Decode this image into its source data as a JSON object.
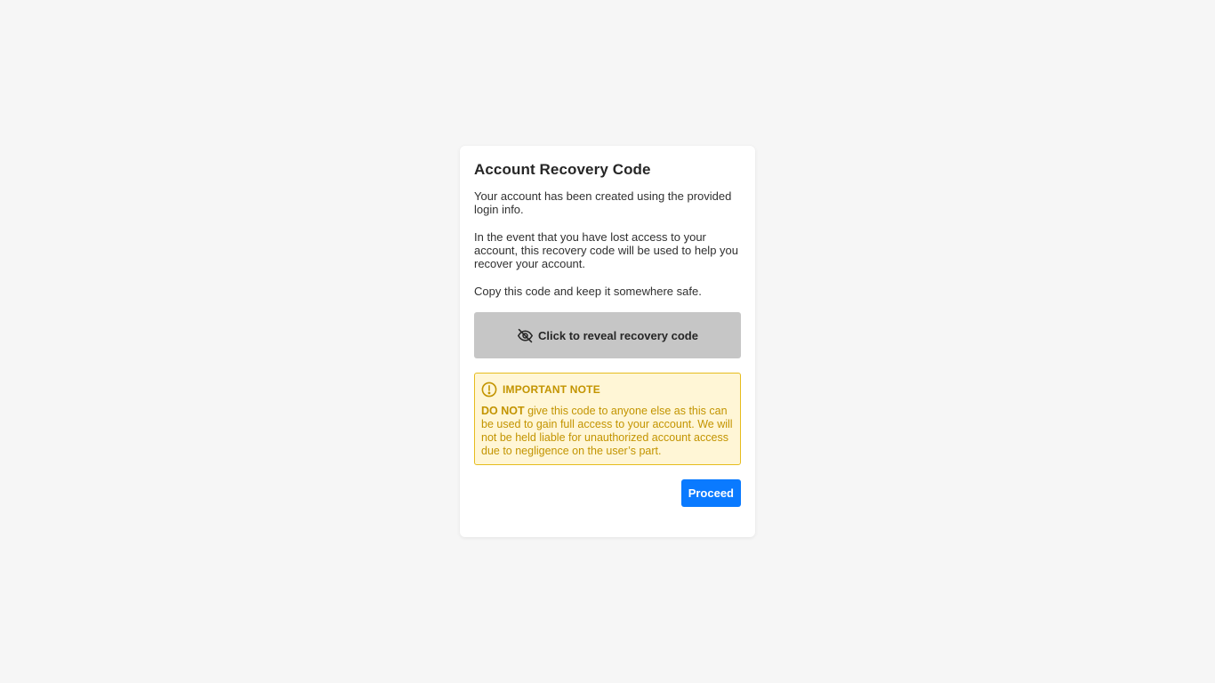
{
  "dialog": {
    "title": "Account Recovery Code",
    "paragraph_1": "Your account has been created using the provided login info.",
    "paragraph_2": "In the event that you have lost access to your account, this recovery code will be used to help you recover your account.",
    "paragraph_3": "Copy this code and keep it somewhere safe.",
    "reveal_button": {
      "label": "Click to reveal recovery code",
      "icon": "eye-off-icon"
    },
    "note": {
      "icon": "alert-circle-icon",
      "heading": "IMPORTANT NOTE",
      "emphasis": "DO NOT",
      "body": " give this code to anyone else as this can be used to gain full access to your account. We will not be held liable for unauthorized account access due to negligence on the user’s part."
    },
    "proceed_button": {
      "label": "Proceed"
    }
  },
  "colors": {
    "background": "#f6f6f6",
    "card": "#ffffff",
    "reveal_bg": "#c6c6c6",
    "note_bg": "#fff6d6",
    "note_border": "#e6bc1e",
    "note_text": "#c39400",
    "primary": "#0a7aff"
  }
}
